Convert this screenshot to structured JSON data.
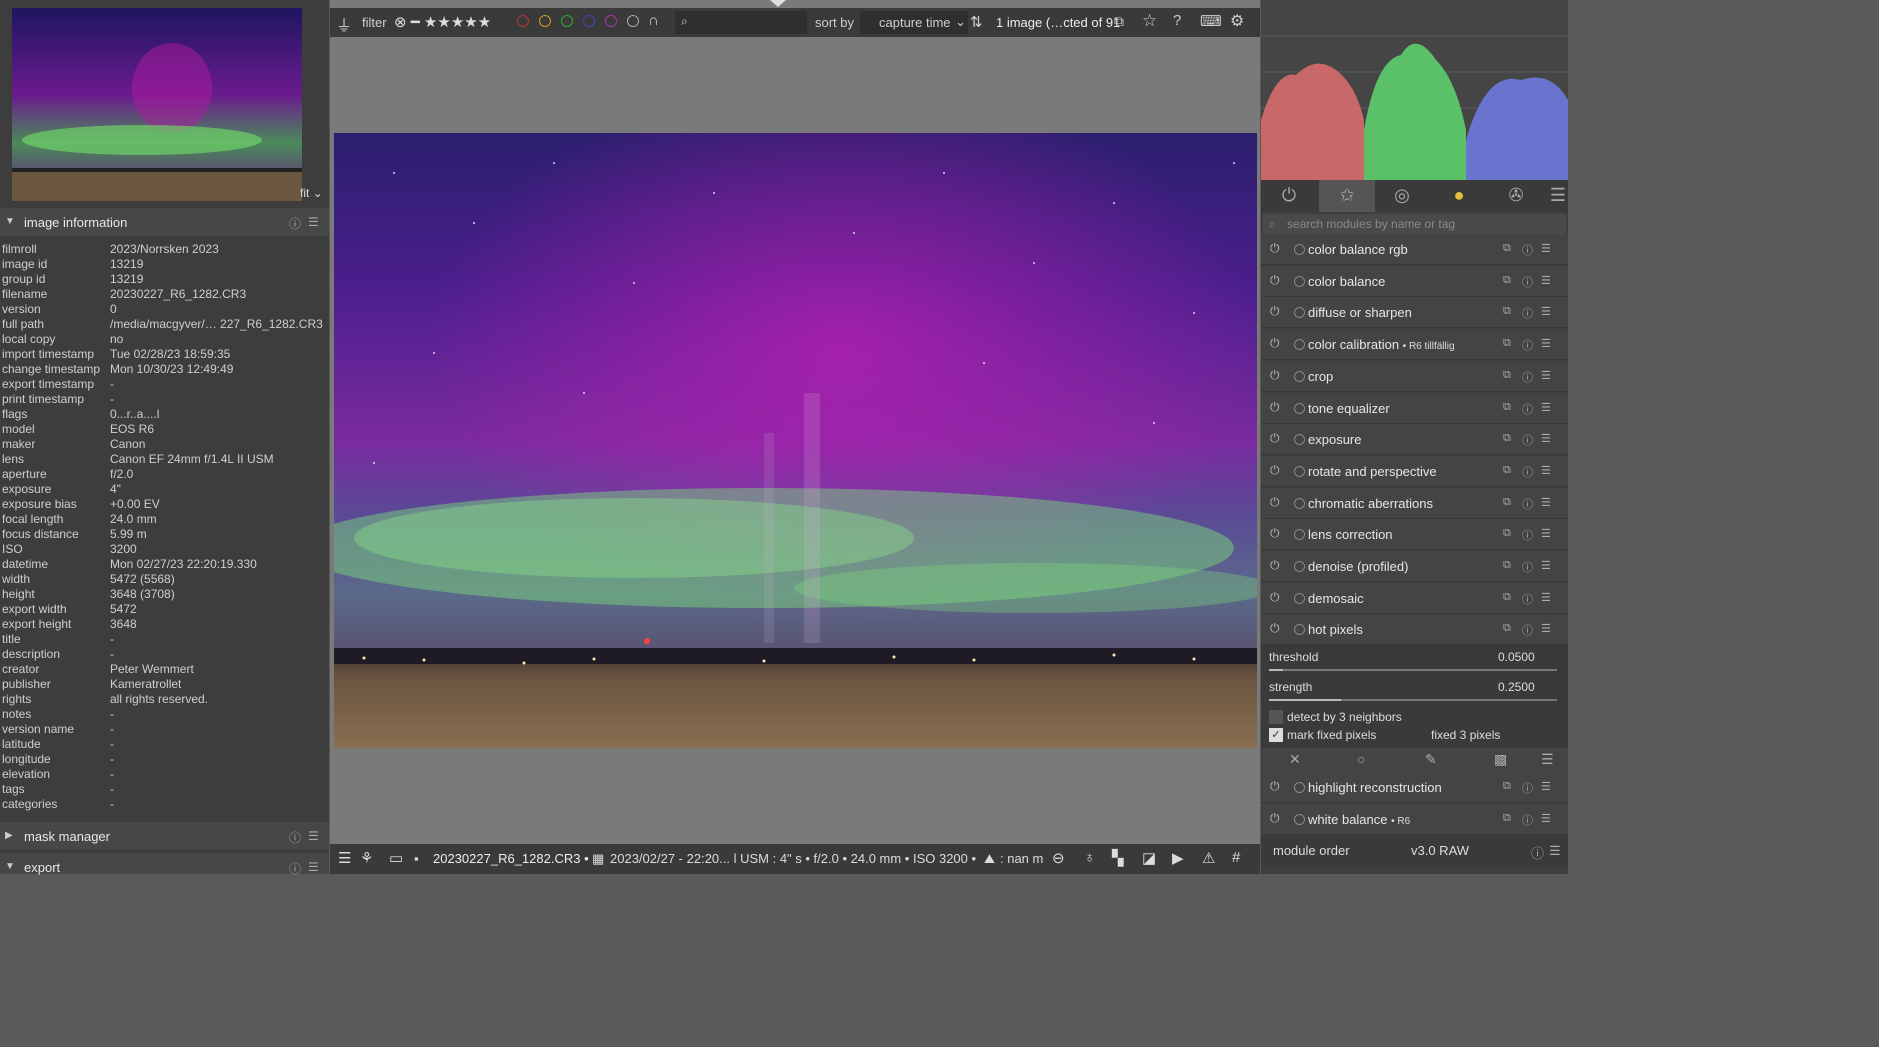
{
  "navigation": {
    "zoom_label": "fit"
  },
  "sections": {
    "image_information": "image information",
    "mask_manager": "mask manager",
    "export": "export"
  },
  "info_rows": [
    {
      "key": "filmroll",
      "value": "2023/Norrsken 2023"
    },
    {
      "key": "image id",
      "value": "13219"
    },
    {
      "key": "group id",
      "value": "13219"
    },
    {
      "key": "filename",
      "value": "20230227_R6_1282.CR3"
    },
    {
      "key": "version",
      "value": "0"
    },
    {
      "key": "full path",
      "value": "/media/macgyver/… 227_R6_1282.CR3"
    },
    {
      "key": "local copy",
      "value": "no"
    },
    {
      "key": "import timestamp",
      "value": "Tue 02/28/23 18:59:35"
    },
    {
      "key": "change timestamp",
      "value": "Mon 10/30/23 12:49:49"
    },
    {
      "key": "export timestamp",
      "value": "-"
    },
    {
      "key": "print timestamp",
      "value": "-"
    },
    {
      "key": "flags",
      "value": "0...r..a....l"
    },
    {
      "key": "model",
      "value": "EOS R6"
    },
    {
      "key": "maker",
      "value": "Canon"
    },
    {
      "key": "lens",
      "value": "Canon EF 24mm f/1.4L II USM"
    },
    {
      "key": "aperture",
      "value": "f/2.0"
    },
    {
      "key": "exposure",
      "value": "4\""
    },
    {
      "key": "exposure bias",
      "value": "+0.00 EV"
    },
    {
      "key": "focal length",
      "value": "24.0 mm"
    },
    {
      "key": "focus distance",
      "value": "5.99 m"
    },
    {
      "key": "ISO",
      "value": "3200"
    },
    {
      "key": "datetime",
      "value": "Mon 02/27/23 22:20:19.330"
    },
    {
      "key": "width",
      "value": "5472 (5568)"
    },
    {
      "key": "height",
      "value": "3648 (3708)"
    },
    {
      "key": "export width",
      "value": "5472"
    },
    {
      "key": "export height",
      "value": "3648"
    },
    {
      "key": "title",
      "value": "-"
    },
    {
      "key": "description",
      "value": "-"
    },
    {
      "key": "creator",
      "value": "Peter Wemmert"
    },
    {
      "key": "publisher",
      "value": "Kameratrollet"
    },
    {
      "key": "rights",
      "value": "all rights reserved."
    },
    {
      "key": "notes",
      "value": "-"
    },
    {
      "key": "version name",
      "value": "-"
    },
    {
      "key": "latitude",
      "value": "-"
    },
    {
      "key": "longitude",
      "value": "-"
    },
    {
      "key": "elevation",
      "value": "-"
    },
    {
      "key": "tags",
      "value": "-"
    },
    {
      "key": "categories",
      "value": "-"
    }
  ],
  "topbar": {
    "filter_label": "filter",
    "sort_label": "sort by",
    "sort_value": "capture time",
    "count_text": "1 image (…cted of 91"
  },
  "bottombar": {
    "filename": "20230227_R6_1282.CR3 •",
    "details": "2023/02/27 - 22:20... l USM : 4\" s • f/2.0 • 24.0 mm • ISO 3200 •",
    "elevation": ": nan m"
  },
  "right": {
    "search_placeholder": "search modules by name or tag",
    "modules": [
      {
        "name": "color balance rgb",
        "suffix": ""
      },
      {
        "name": "color balance",
        "suffix": ""
      },
      {
        "name": "diffuse or sharpen",
        "suffix": ""
      },
      {
        "name": "color calibration",
        "suffix": "• R6 tillfällig"
      },
      {
        "name": "crop",
        "suffix": ""
      },
      {
        "name": "tone equalizer",
        "suffix": ""
      },
      {
        "name": "exposure",
        "suffix": ""
      },
      {
        "name": "rotate and perspective",
        "suffix": ""
      },
      {
        "name": "chromatic aberrations",
        "suffix": ""
      },
      {
        "name": "lens correction",
        "suffix": ""
      },
      {
        "name": "denoise (profiled)",
        "suffix": ""
      },
      {
        "name": "demosaic",
        "suffix": ""
      },
      {
        "name": "hot pixels",
        "suffix": ""
      }
    ],
    "hotpixels": {
      "threshold_label": "threshold",
      "threshold_value": "0.0500",
      "threshold_level": 0.05,
      "strength_label": "strength",
      "strength_value": "0.2500",
      "strength_level": 0.25,
      "detect_label": "detect by 3 neighbors",
      "mark_label": "mark fixed pixels",
      "fixed_text": "fixed 3 pixels"
    },
    "modules2": [
      {
        "name": "highlight reconstruction",
        "suffix": ""
      },
      {
        "name": "white balance",
        "suffix": "• R6"
      }
    ],
    "module_order_label": "module order",
    "module_order_value": "v3.0 RAW"
  }
}
